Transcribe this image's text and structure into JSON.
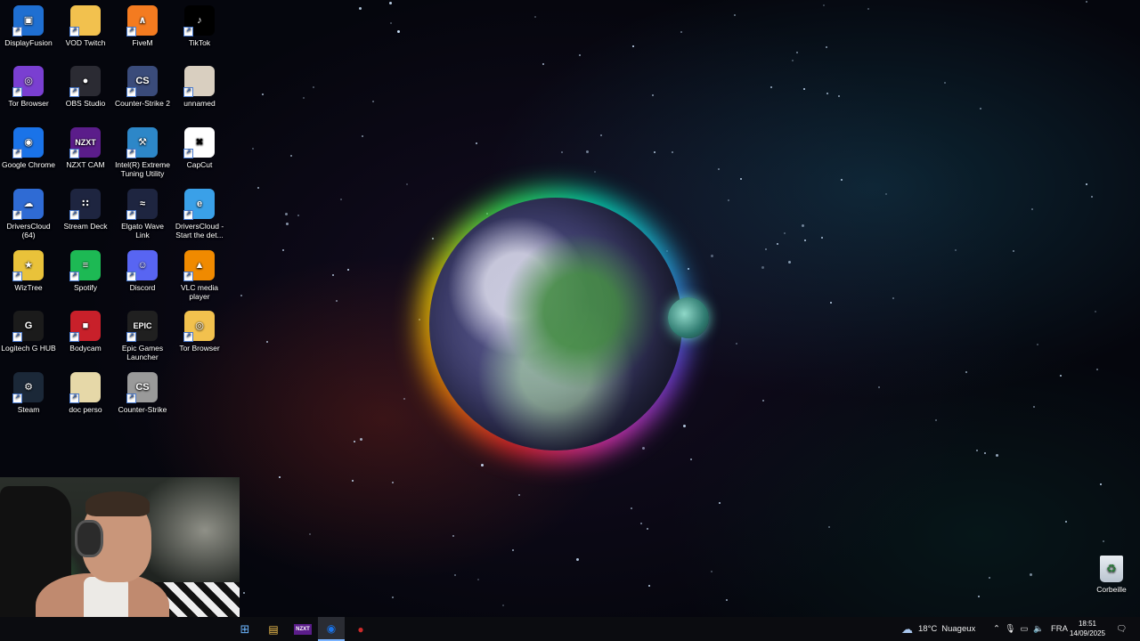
{
  "desktop": {
    "icons": [
      {
        "label": "DisplayFusion",
        "icon": "displayfusion-icon",
        "glyph": "▣",
        "color": "#1f6fd1"
      },
      {
        "label": "VOD Twitch",
        "icon": "folder-icon",
        "glyph": "",
        "color": "#f2c14e"
      },
      {
        "label": "FiveM",
        "icon": "fivem-icon",
        "glyph": "∧",
        "color": "#f47b20"
      },
      {
        "label": "TikTok",
        "icon": "tiktok-icon",
        "glyph": "♪",
        "color": "#000000"
      },
      {
        "label": "Tor Browser",
        "icon": "tor-browser-icon",
        "glyph": "◎",
        "color": "#7a3fd1"
      },
      {
        "label": "OBS Studio",
        "icon": "obs-studio-icon",
        "glyph": "●",
        "color": "#2b2b33"
      },
      {
        "label": "Counter-Strike 2",
        "icon": "counter-strike-2-icon",
        "glyph": "CS",
        "color": "#3a4b7a"
      },
      {
        "label": "unnamed",
        "icon": "image-file-icon",
        "glyph": "",
        "color": "#d9cfc0"
      },
      {
        "label": "Google Chrome",
        "icon": "chrome-icon",
        "glyph": "◉",
        "color": "#1a73e8"
      },
      {
        "label": "NZXT CAM",
        "icon": "nzxt-cam-icon",
        "glyph": "NZXT",
        "color": "#5b1d8a"
      },
      {
        "label": "Intel(R) Extreme Tuning Utility",
        "icon": "intel-xtu-icon",
        "glyph": "⚒",
        "color": "#2d87c8"
      },
      {
        "label": "CapCut",
        "icon": "capcut-icon",
        "glyph": "✖",
        "color": "#ffffff"
      },
      {
        "label": "DriversCloud (64)",
        "icon": "driverscloud-icon",
        "glyph": "☁",
        "color": "#2f6bd4"
      },
      {
        "label": "Stream Deck",
        "icon": "stream-deck-icon",
        "glyph": "∷",
        "color": "#1e2540"
      },
      {
        "label": "Elgato Wave Link",
        "icon": "elgato-wave-link-icon",
        "glyph": "≈",
        "color": "#1e2540"
      },
      {
        "label": "DriversCloud - Start the det...",
        "icon": "driverscloud-web-icon",
        "glyph": "e",
        "color": "#3aa0e8"
      },
      {
        "label": "WizTree",
        "icon": "wiztree-icon",
        "glyph": "★",
        "color": "#e9c23a"
      },
      {
        "label": "Spotify",
        "icon": "spotify-icon",
        "glyph": "≡",
        "color": "#1db954"
      },
      {
        "label": "Discord",
        "icon": "discord-icon",
        "glyph": "☺",
        "color": "#5865f2"
      },
      {
        "label": "VLC media player",
        "icon": "vlc-icon",
        "glyph": "▲",
        "color": "#f08a00"
      },
      {
        "label": "Logitech G HUB",
        "icon": "logitech-g-hub-icon",
        "glyph": "G",
        "color": "#1b1b1b"
      },
      {
        "label": "Bodycam",
        "icon": "bodycam-icon",
        "glyph": "■",
        "color": "#c8202a"
      },
      {
        "label": "Epic Games Launcher",
        "icon": "epic-games-icon",
        "glyph": "EPIC",
        "color": "#202020"
      },
      {
        "label": "Tor Browser",
        "icon": "tor-browser-file-icon",
        "glyph": "◎",
        "color": "#f2c14e"
      },
      {
        "label": "Steam",
        "icon": "steam-icon",
        "glyph": "⚙",
        "color": "#1b2838"
      },
      {
        "label": "doc perso",
        "icon": "document-folder-icon",
        "glyph": "",
        "color": "#e6d8a8"
      },
      {
        "label": "Counter-Strike",
        "icon": "counter-strike-icon",
        "glyph": "CS",
        "color": "#9a9a9a"
      }
    ],
    "recycle_bin": {
      "label": "Corbeille"
    }
  },
  "taskbar": {
    "apps": [
      {
        "name": "taskbar-file-explorer",
        "glyph": "▤",
        "color": "#f2c14e"
      },
      {
        "name": "taskbar-nzxt-cam",
        "glyph": "NZXT",
        "color": "#5b1d8a"
      },
      {
        "name": "taskbar-google-chrome",
        "glyph": "◉",
        "color": "#1a73e8"
      },
      {
        "name": "taskbar-recorder",
        "glyph": "●",
        "color": "#cc2a2a"
      }
    ],
    "weather": {
      "temp": "18°C",
      "condition": "Nuageux"
    },
    "language": "FRA",
    "time": "18:51",
    "date": "14/09/2025"
  }
}
